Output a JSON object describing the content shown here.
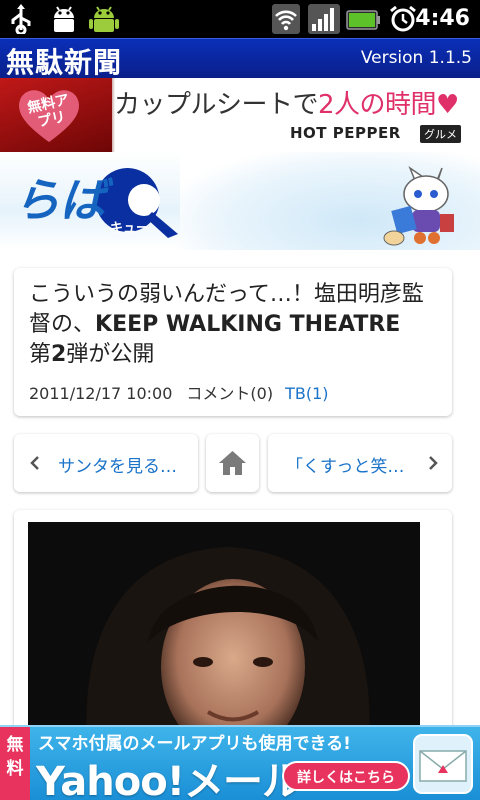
{
  "statusbar": {
    "time": "4:46",
    "icons": [
      "usb-icon",
      "android-debug-icon",
      "android-icon",
      "wifi-icon",
      "signal-icon",
      "battery-icon",
      "alarm-icon"
    ]
  },
  "app": {
    "title": "無駄新聞",
    "version": "Version 1.1.5"
  },
  "ad_top": {
    "badge": "無料アプリ",
    "headline_pre": "カップルシートで",
    "headline_pink": "2人の時間♥",
    "brand": "HOT PEPPER",
    "brand_tag": "グルメ"
  },
  "brand_banner": {
    "logo_text": "らば",
    "logo_q": "Q",
    "logo_kana": "キュー"
  },
  "article": {
    "title_part1": "こういうの弱いんだって…！塩田明彦監督の、",
    "title_bold": "KEEP WALKING THEATRE",
    "title_part2": "第",
    "title_bold2": "2",
    "title_part3": "弾が公開",
    "datetime": "2011/12/17 10:00",
    "comments": "コメント(0)",
    "trackback": "TB(1)"
  },
  "nav": {
    "prev_label": "サンタを見る…",
    "next_label": "「くすっと笑…",
    "home_icon": "home-icon"
  },
  "ad_bottom": {
    "free_label": "無料",
    "line1": "スマホ付属のメールアプリも使用できる!",
    "line2": "Yahoo!メール",
    "detail_button": "詳しくはこちら",
    "icon": "mail-envelope-icon"
  },
  "colors": {
    "titlebar": "#0a2fb8",
    "link": "#1a73c8",
    "ad_pink": "#e8335e",
    "ad_blue": "#1a8fd6"
  }
}
